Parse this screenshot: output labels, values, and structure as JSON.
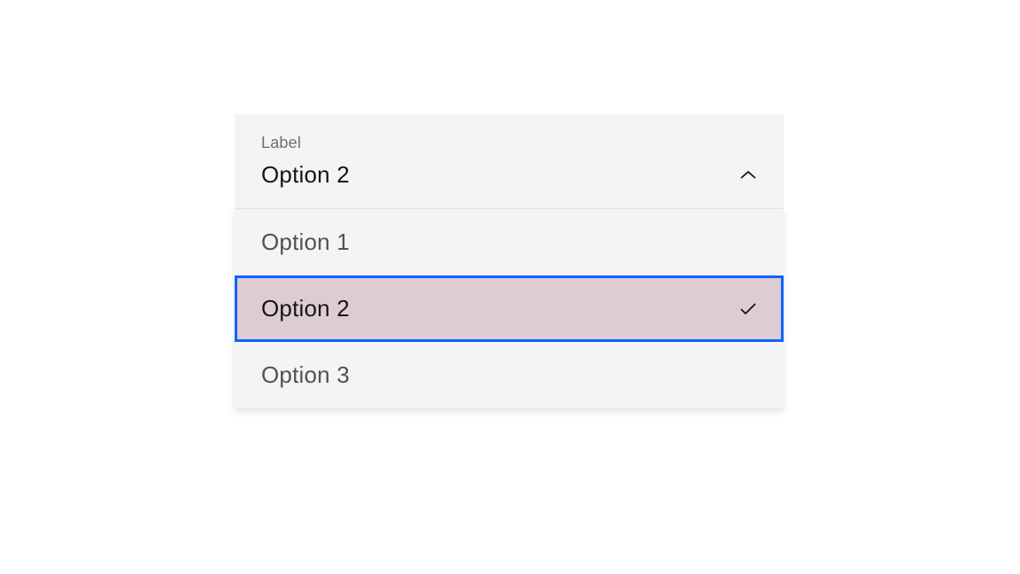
{
  "dropdown": {
    "label": "Label",
    "selected": "Option 2",
    "options": [
      {
        "label": "Option 1",
        "selected": false
      },
      {
        "label": "Option 2",
        "selected": true
      },
      {
        "label": "Option 3",
        "selected": false
      }
    ]
  },
  "colors": {
    "background": "#f4f4f4",
    "selectedBg": "#dfccd2",
    "focusOutline": "#0f62fe",
    "textPrimary": "#161616",
    "textSecondary": "#6f6f6f"
  }
}
